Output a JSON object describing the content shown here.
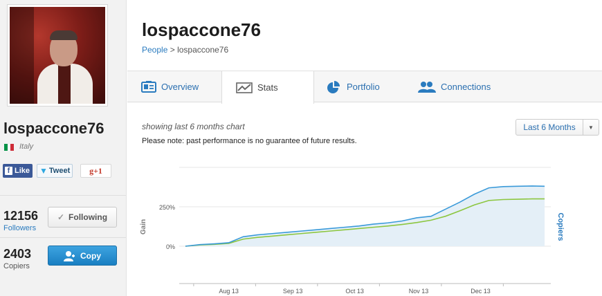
{
  "sidebar": {
    "username": "lospaccone76",
    "country": "Italy",
    "flag_colors": [
      "#009246",
      "#ffffff",
      "#ce2b37"
    ],
    "social": {
      "facebook": "Like",
      "twitter": "Tweet",
      "gplus": "+1"
    },
    "followers": {
      "count": "12156",
      "label": "Followers",
      "button": "Following"
    },
    "copiers": {
      "count": "2403",
      "label": "Copiers",
      "button": "Copy"
    }
  },
  "header": {
    "title": "lospaccone76",
    "breadcrumb": {
      "root": "People",
      "sep": ">",
      "current": "lospaccone76"
    }
  },
  "tabs": [
    {
      "label": "Overview",
      "icon": "id-card-icon",
      "active": false
    },
    {
      "label": "Stats",
      "icon": "line-chart-icon",
      "active": true
    },
    {
      "label": "Portfolio",
      "icon": "pie-chart-icon",
      "active": false
    },
    {
      "label": "Connections",
      "icon": "people-icon",
      "active": false
    }
  ],
  "stats": {
    "showing": "showing last 6 months chart",
    "disclaimer": "Please note: past performance is no guarantee of future results.",
    "range_selected": "Last 6 Months"
  },
  "colors": {
    "accent": "#2a7bbf",
    "gain_line": "#3a9ad9",
    "copiers_line": "#8cc63f",
    "area": "#e4eff7"
  },
  "chart_data": {
    "type": "line",
    "title": "",
    "ylabel": "Gain",
    "y2label": "Copiers",
    "yticks": [
      "250%",
      "0%"
    ],
    "xticks": [
      "Aug 13",
      "Sep 13",
      "Oct 13",
      "Nov 13",
      "Dec 13"
    ],
    "grid": true,
    "series": [
      {
        "name": "Gain",
        "x": [
          "2013-07-25",
          "2013-08-01",
          "2013-08-08",
          "2013-08-15",
          "2013-08-22",
          "2013-08-29",
          "2013-09-05",
          "2013-09-12",
          "2013-09-19",
          "2013-09-26",
          "2013-10-03",
          "2013-10-10",
          "2013-10-17",
          "2013-10-24",
          "2013-10-31",
          "2013-11-07",
          "2013-11-14",
          "2013-11-21",
          "2013-11-28",
          "2013-12-05",
          "2013-12-12",
          "2013-12-19",
          "2013-12-26",
          "2014-01-02",
          "2014-01-09",
          "2014-01-15"
        ],
        "values": [
          0,
          10,
          15,
          22,
          60,
          72,
          80,
          88,
          96,
          104,
          112,
          120,
          128,
          140,
          148,
          160,
          180,
          190,
          235,
          280,
          330,
          370,
          378,
          380,
          382,
          380
        ]
      },
      {
        "name": "Copiers",
        "x": [
          "2013-07-25",
          "2013-08-01",
          "2013-08-08",
          "2013-08-15",
          "2013-08-22",
          "2013-08-29",
          "2013-09-05",
          "2013-09-12",
          "2013-09-19",
          "2013-09-26",
          "2013-10-03",
          "2013-10-10",
          "2013-10-17",
          "2013-10-24",
          "2013-10-31",
          "2013-11-07",
          "2013-11-14",
          "2013-11-21",
          "2013-11-28",
          "2013-12-05",
          "2013-12-12",
          "2013-12-19",
          "2013-12-26",
          "2014-01-02",
          "2014-01-09",
          "2014-01-15"
        ],
        "values": [
          0,
          8,
          12,
          18,
          45,
          56,
          64,
          72,
          80,
          88,
          96,
          104,
          112,
          120,
          128,
          138,
          150,
          165,
          190,
          225,
          262,
          290,
          296,
          298,
          300,
          300
        ]
      }
    ]
  }
}
